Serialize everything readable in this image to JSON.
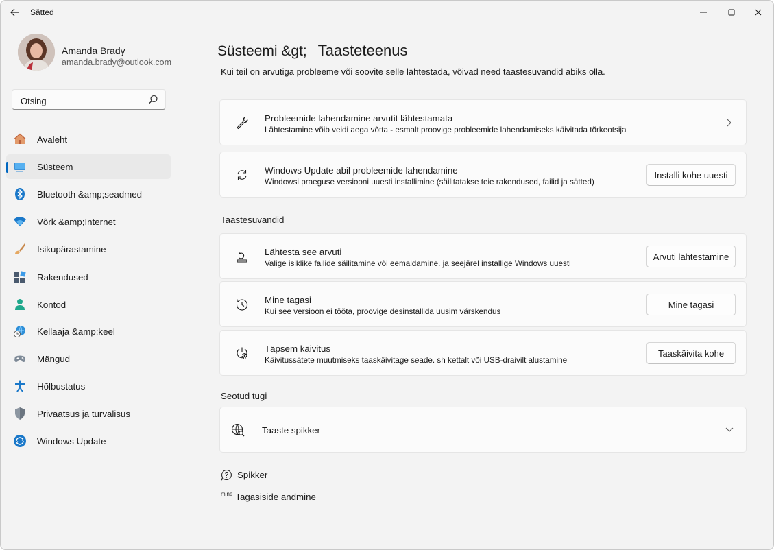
{
  "window": {
    "title": "Sätted"
  },
  "user": {
    "name": "Amanda Brady",
    "email": "amanda.brady@outlook.com"
  },
  "search": {
    "value": "Otsing"
  },
  "nav": {
    "items": [
      {
        "label": "Avaleht",
        "icon": "home-icon"
      },
      {
        "label": "Süsteem",
        "icon": "system-icon",
        "selected": true
      },
      {
        "label": "Bluetooth &amp;seadmed",
        "icon": "bluetooth-icon"
      },
      {
        "label": "Võrk &amp;Internet",
        "icon": "wifi-icon"
      },
      {
        "label": "Isikupärastamine",
        "icon": "brush-icon"
      },
      {
        "label": "Rakendused",
        "icon": "apps-icon"
      },
      {
        "label": "Kontod",
        "icon": "account-icon"
      },
      {
        "label": "Kellaaja &amp;keel",
        "icon": "time-language-icon"
      },
      {
        "label": "Mängud",
        "icon": "gaming-icon"
      },
      {
        "label": "Hõlbustatus",
        "icon": "accessibility-icon"
      },
      {
        "label": "Privaatsus ja turvalisus",
        "icon": "shield-icon"
      },
      {
        "label": "Windows Update",
        "icon": "update-icon"
      }
    ]
  },
  "page": {
    "breadcrumb_parent": "Süsteemi",
    "breadcrumb_sep": "&gt;",
    "title": "Taasteteenus",
    "description": "Kui teil on arvutiga probleeme või soovite selle lähtestada, võivad need taastesuvandid abiks olla."
  },
  "cards": {
    "troubleshoot": {
      "title": "Probleemide lahendamine arvutit lähtestamata",
      "subtitle": "Lähtestamine võib veidi aega võtta - esmalt proovige probleemide lahendamiseks käivitada tõrkeotsija"
    },
    "windows_update": {
      "title": "Windows Update abil probleemide lahendamine",
      "subtitle": "Windowsi praeguse versiooni uuesti installimine (säilitatakse teie rakendused, failid ja sätted)",
      "button": "Installi kohe uuesti"
    }
  },
  "sections": {
    "recovery_options": "Taastesuvandid",
    "related_support": "Seotud tugi"
  },
  "recovery": {
    "reset": {
      "title": "Lähtesta see arvuti",
      "subtitle": "Valige isiklike failide säilitamine või eemaldamine. ja seejärel installige Windows uuesti",
      "button": "Arvuti lähtestamine"
    },
    "go_back": {
      "title": "Mine tagasi",
      "subtitle": "Kui see versioon ei tööta, proovige desinstallida uusim värskendus",
      "button": "Mine tagasi"
    },
    "advanced": {
      "title": "Täpsem käivitus",
      "subtitle": "Käivitussätete muutmiseks taaskäivitage seade. sh kettalt või USB-draivilt alustamine",
      "button": "Taaskäivita kohe"
    }
  },
  "support": {
    "recovery_help": "Taaste spikker"
  },
  "footer": {
    "help": "Spikker",
    "feedback_prefix": "mine",
    "feedback": "Tagasiside andmine"
  },
  "colors": {
    "accent": "#0067c0",
    "background": "#f3f3f3",
    "card": "#fbfbfb"
  }
}
